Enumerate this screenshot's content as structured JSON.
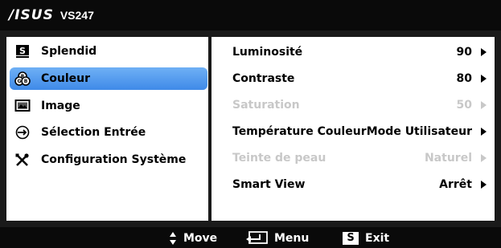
{
  "header": {
    "brand": "/ISUS",
    "model": "VS247"
  },
  "menu": {
    "items": [
      {
        "label": "Splendid",
        "icon": "splendid-icon"
      },
      {
        "label": "Couleur",
        "icon": "color-icon",
        "selected": true
      },
      {
        "label": "Image",
        "icon": "image-icon"
      },
      {
        "label": "Sélection Entrée",
        "icon": "input-select-icon"
      },
      {
        "label": "Configuration Système",
        "icon": "system-setup-icon"
      }
    ]
  },
  "settings": {
    "rows": [
      {
        "label": "Luminosité",
        "value": "90",
        "enabled": true
      },
      {
        "label": "Contraste",
        "value": "80",
        "enabled": true
      },
      {
        "label": "Saturation",
        "value": "50",
        "enabled": false
      },
      {
        "label": "Température  Couleur",
        "value": "Mode Utilisateur",
        "enabled": true
      },
      {
        "label": "Teinte de peau",
        "value": "Naturel",
        "enabled": false
      },
      {
        "label": "Smart View",
        "value": "Arrêt",
        "enabled": true
      }
    ]
  },
  "footer": {
    "move_label": "Move",
    "menu_label": "Menu",
    "exit_label": "Exit",
    "exit_key": "S"
  },
  "colors": {
    "selection": "#4a94ec",
    "disabled_text": "#c8c8c8",
    "osd_background": "#000000"
  }
}
